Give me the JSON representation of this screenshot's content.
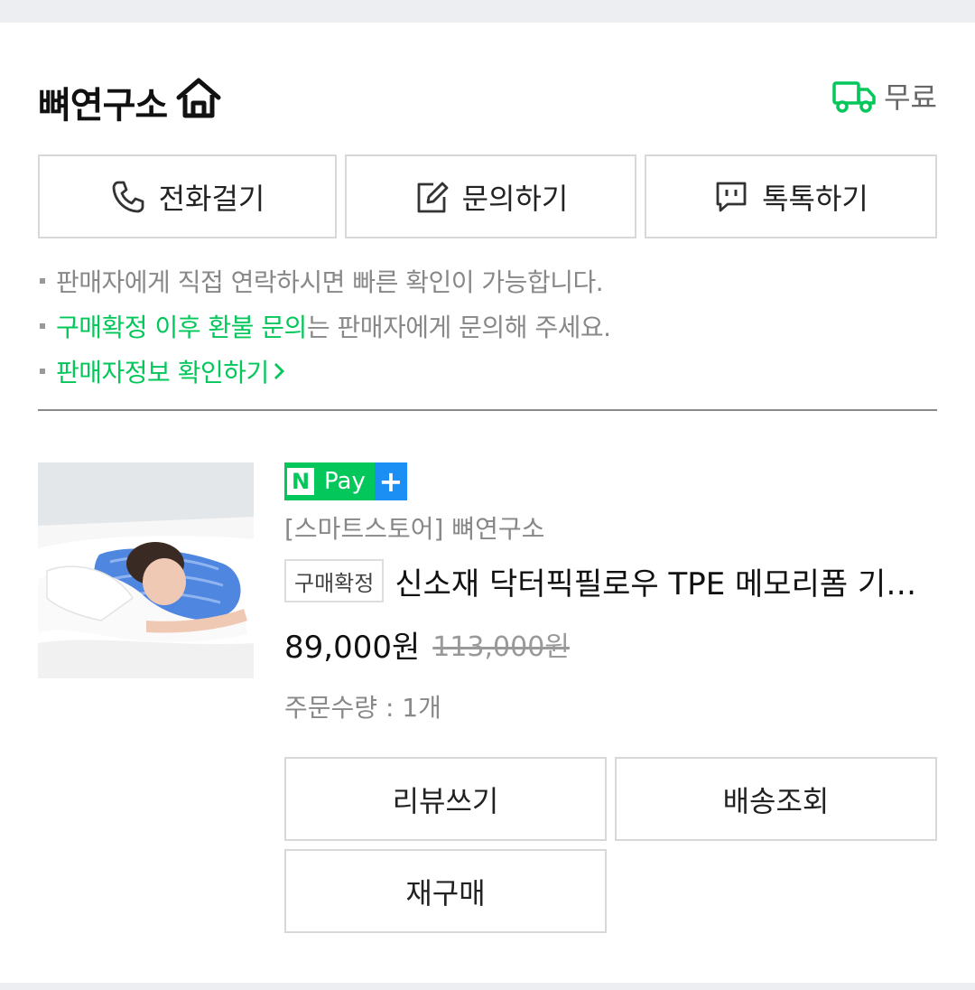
{
  "store": {
    "name": "뼈연구소",
    "delivery_label": "무료"
  },
  "contact": {
    "call_label": "전화걸기",
    "inquiry_label": "문의하기",
    "talk_label": "톡톡하기"
  },
  "notices": {
    "line1": "판매자에게 직접 연락하시면 빠른 확인이 가능합니다.",
    "line2_highlight": "구매확정 이후 환불 문의",
    "line2_rest": "는 판매자에게 문의해 주세요.",
    "line3": "판매자정보 확인하기"
  },
  "product": {
    "pay_badge_n": "N",
    "pay_badge_text": "Pay",
    "pay_badge_plus": "+",
    "store_tag": "[스마트스토어] 뼈연구소",
    "status_badge": "구매확정",
    "title": "신소재 닥터픽필로우 TPE 메모리폼 기능성 베개",
    "price": "89,000원",
    "original_price": "113,000원",
    "quantity": "주문수량 : 1개"
  },
  "actions": {
    "review_label": "리뷰쓰기",
    "tracking_label": "배송조회",
    "rebuy_label": "재구매"
  },
  "colors": {
    "accent_green": "#03c75a",
    "npay_blue": "#1c8ff5"
  }
}
